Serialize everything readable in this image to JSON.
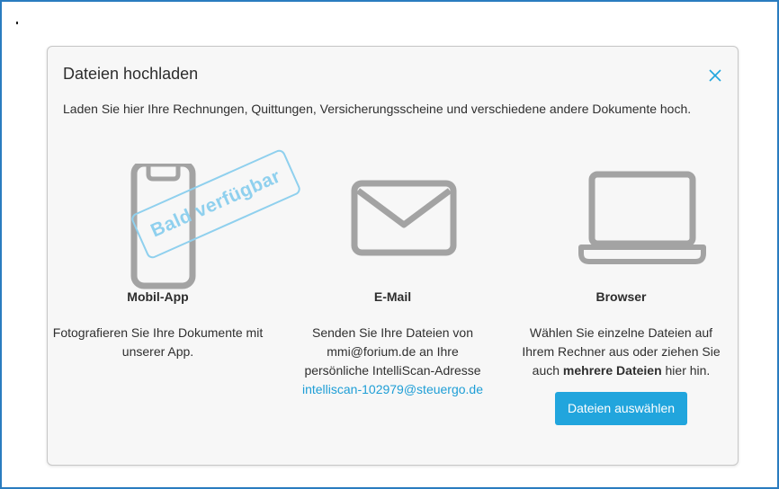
{
  "dialog": {
    "title": "Dateien hochladen",
    "description": "Laden Sie hier Ihre Rechnungen, Quittungen, Versicherungsscheine und verschiedene andere Dokumente hoch."
  },
  "options": [
    {
      "title": "Mobil-App",
      "text": "Fotografieren Sie Ihre Dokumente mit unserer App.",
      "icon": "smartphone-icon",
      "stamp": "Bald verfügbar"
    },
    {
      "title": "E-Mail",
      "text_line1": "Senden Sie Ihre Dateien von",
      "text_line2": "mmi@forium.de an Ihre",
      "text_line3": "persönliche IntelliScan-Adresse",
      "address": "intelliscan-102979@steuergo.de",
      "icon": "envelope-icon"
    },
    {
      "title": "Browser",
      "text_line1": "Wählen Sie einzelne Dateien auf",
      "text_line2": "Ihrem Rechner aus oder ziehen Sie",
      "text_line3_prefix": "auch",
      "text_line3_bold": "mehrere Dateien",
      "text_line3_suffix": "hier hin.",
      "button": "Dateien auswählen",
      "icon": "laptop-icon"
    }
  ],
  "colors": {
    "accent": "#21a5dd",
    "link": "#1e9ed6",
    "icon_gray": "#a3a3a3",
    "stamp": "#8fd0ee",
    "frame": "#2a7cbf"
  }
}
